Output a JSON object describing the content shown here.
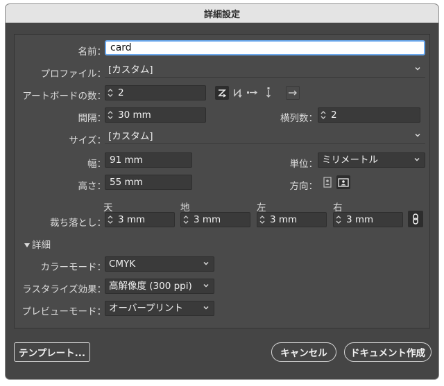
{
  "window": {
    "title": "詳細設定"
  },
  "name": {
    "label": "名前：",
    "value": "card"
  },
  "profile": {
    "label": "プロファイル：",
    "value": "[カスタム]"
  },
  "artboards": {
    "count_label": "アートボードの数：",
    "count_value": "2",
    "arrange_icons": [
      "grid-by-row-icon",
      "grid-by-column-icon",
      "arrange-by-row-icon",
      "arrange-by-column-icon",
      "right-to-left-icon"
    ],
    "spacing_label": "間隔：",
    "spacing_value": "30 mm",
    "columns_label": "横列数：",
    "columns_value": "2"
  },
  "size": {
    "label": "サイズ：",
    "value": "[カスタム]"
  },
  "width": {
    "label": "幅：",
    "value": "91 mm"
  },
  "units": {
    "label": "単位：",
    "value": "ミリメートル"
  },
  "height": {
    "label": "高さ：",
    "value": "55 mm"
  },
  "orientation": {
    "label": "方向：",
    "options": [
      "portrait-icon",
      "landscape-icon"
    ],
    "selected": "landscape"
  },
  "bleed": {
    "label": "裁ち落とし：",
    "top_label": "天",
    "top_value": "3 mm",
    "bottom_label": "地",
    "bottom_value": "3 mm",
    "left_label": "左",
    "left_value": "3 mm",
    "right_label": "右",
    "right_value": "3 mm",
    "link_icon": "link-icon"
  },
  "advanced": {
    "toggle_label": "詳細",
    "color_mode_label": "カラーモード：",
    "color_mode_value": "CMYK",
    "raster_label": "ラスタライズ効果：",
    "raster_value": "高解像度 (300 ppi)",
    "preview_label": "プレビューモード：",
    "preview_value": "オーバープリント"
  },
  "footer": {
    "templates_label": "テンプレート...",
    "cancel_label": "キャンセル",
    "create_label": "ドキュメント作成"
  }
}
